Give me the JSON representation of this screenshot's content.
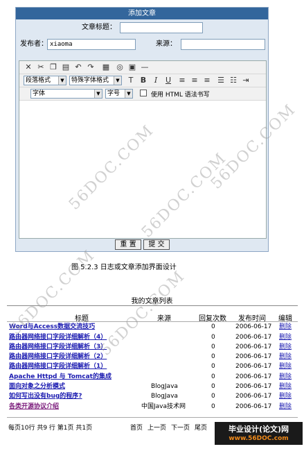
{
  "form": {
    "panel_title": "添加文章",
    "title_label": "文章标题：",
    "title_value": "",
    "publisher_label": "发布者：",
    "publisher_value": "xiaoma",
    "source_label": "来源：",
    "source_value": "",
    "toolbar1_icons": [
      "cut-icon",
      "copy-icon",
      "paste-icon",
      "paste-text-icon",
      "undo-icon",
      "redo-icon",
      "table-icon",
      "web-icon",
      "image-icon",
      "hr-icon"
    ],
    "paragraph_select": "段落格式",
    "special_select": "特殊字体格式",
    "font_select": "字体",
    "size_select": "字号",
    "html_checkbox_label": "使用  HTML  语法书写",
    "reset_button": "重 置",
    "submit_button": "提 交"
  },
  "caption": "图 5.2.3 日志或文章添加界面设计",
  "list": {
    "title": "我的文章列表",
    "headers": {
      "title": "标题",
      "source": "来源",
      "replies": "回复次数",
      "time": "发布时间",
      "edit": "编辑"
    },
    "rows": [
      {
        "title": "Word与Access数据交流技巧",
        "source": "",
        "replies": "0",
        "time": "2006-06-17",
        "edit": "删除"
      },
      {
        "title": "路由器网络接口字段详细解析（4）",
        "source": "",
        "replies": "0",
        "time": "2006-06-17",
        "edit": "删除"
      },
      {
        "title": "路由器网络接口字段详细解析（3）",
        "source": "",
        "replies": "0",
        "time": "2006-06-17",
        "edit": "删除"
      },
      {
        "title": "路由器网络接口字段详细解析（2）",
        "source": "",
        "replies": "0",
        "time": "2006-06-17",
        "edit": "删除"
      },
      {
        "title": "路由器网络接口字段详细解析（1）",
        "source": "",
        "replies": "0",
        "time": "2006-06-17",
        "edit": "删除"
      },
      {
        "title": "Apache Httpd 与 Tomcat的集成",
        "source": "",
        "replies": "0",
        "time": "2006-06-17",
        "edit": "删除"
      },
      {
        "title": "面向对象之分析模式",
        "source": "BlogJava",
        "replies": "0",
        "time": "2006-06-17",
        "edit": "删除"
      },
      {
        "title": "如何写出没有bug的程序?",
        "source": "BlogJava",
        "replies": "0",
        "time": "2006-06-17",
        "edit": "删除"
      },
      {
        "title": "各类开源协议介绍",
        "source": "中国Java技术网",
        "replies": "0",
        "time": "2006-06-17",
        "edit": "删除"
      }
    ],
    "pager_info": "每页10行  共9  行  第1页  共1页",
    "first": "首页",
    "prev": "上一页",
    "next": "下一页",
    "last": "尾页"
  },
  "brand": {
    "line1": "毕业设计(论文)网",
    "line2": "www.56DOC.com"
  },
  "watermark": "56DOC.COM"
}
